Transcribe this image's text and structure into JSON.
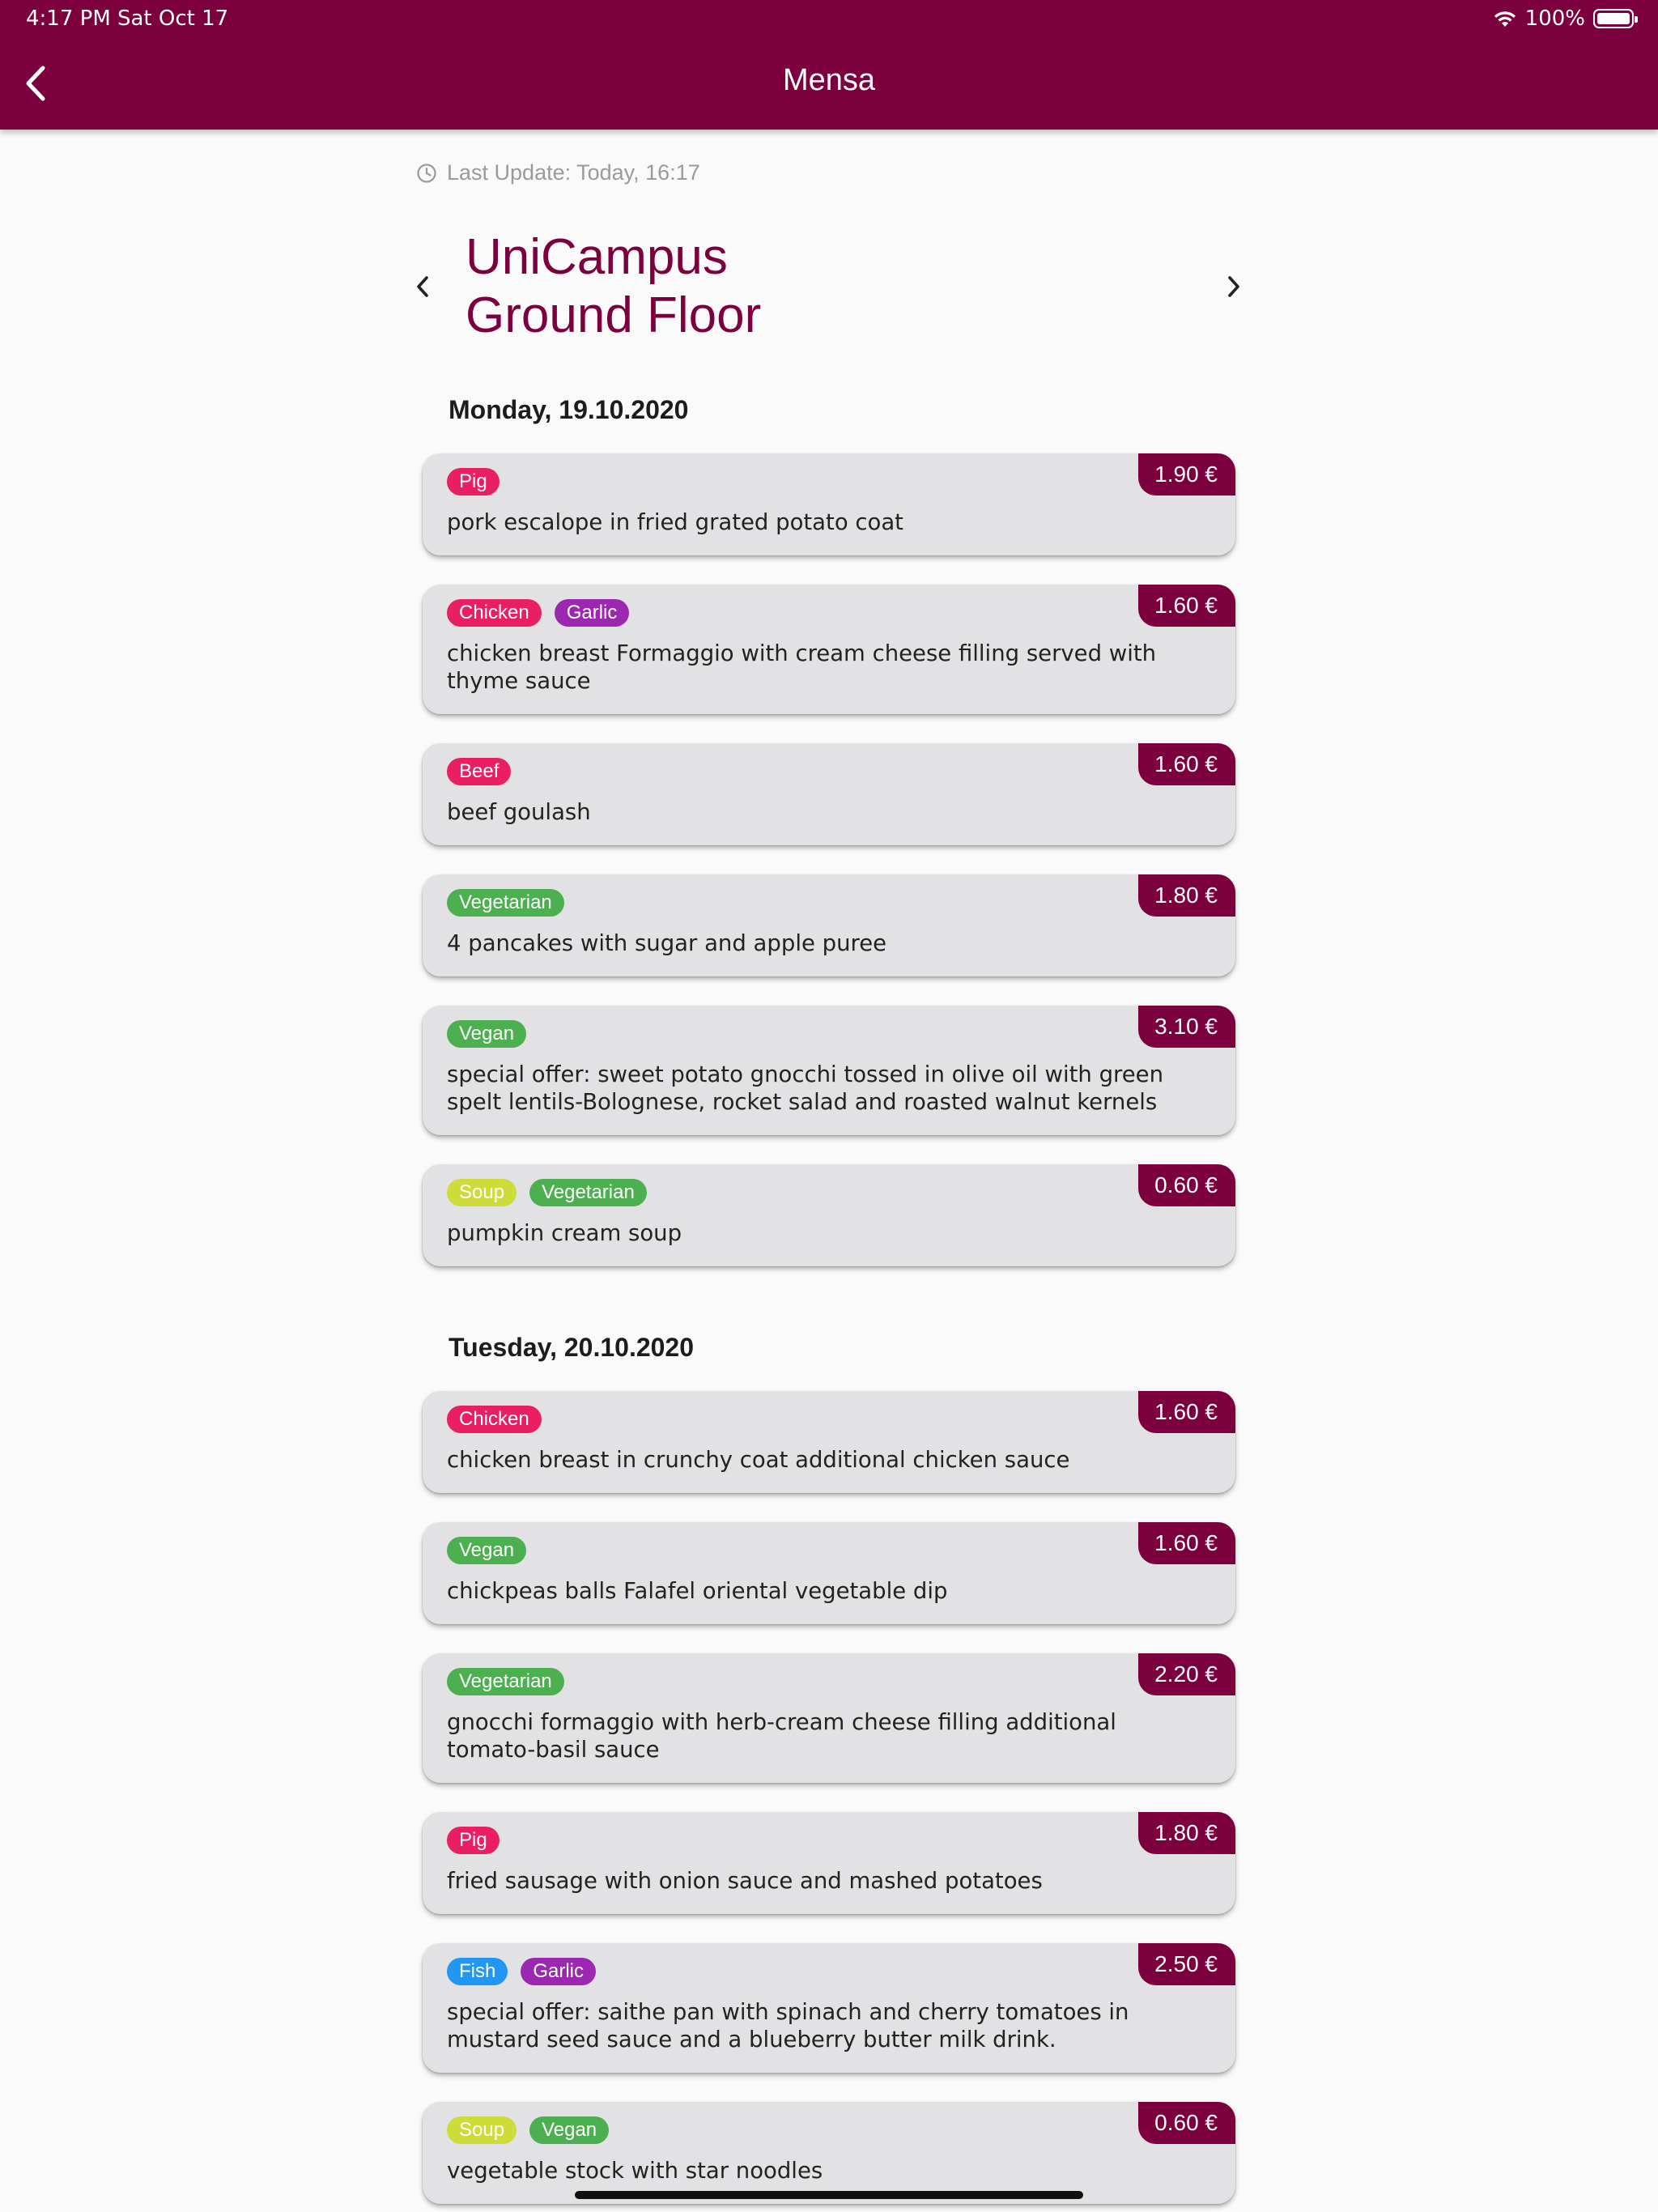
{
  "status_bar": {
    "time": "4:17 PM",
    "date": "Sat Oct 17",
    "battery": "100%"
  },
  "appbar": {
    "title": "Mensa"
  },
  "last_update": "Last Update: Today, 16:17",
  "location": {
    "line1": "UniCampus",
    "line2": "Ground Floor"
  },
  "colors": {
    "brand": "#7b003d",
    "tag_meat": "#e91e63",
    "tag_garlic": "#9c27b0",
    "tag_veg": "#4caf50",
    "tag_soup": "#cddc39",
    "tag_fish": "#2196f3"
  },
  "days": [
    {
      "date": "Monday, 19.10.2020",
      "meals": [
        {
          "tags": [
            "Pig"
          ],
          "name": "pork escalope in fried grated potato coat",
          "price": "1.90 €"
        },
        {
          "tags": [
            "Chicken",
            "Garlic"
          ],
          "name": "chicken breast Formaggio with cream cheese filling served with thyme sauce",
          "price": "1.60 €"
        },
        {
          "tags": [
            "Beef"
          ],
          "name": "beef goulash",
          "price": "1.60 €"
        },
        {
          "tags": [
            "Vegetarian"
          ],
          "name": "4 pancakes with sugar and apple puree",
          "price": "1.80 €"
        },
        {
          "tags": [
            "Vegan"
          ],
          "name": "special offer: sweet potato gnocchi tossed in olive oil with green spelt lentils-Bolognese, rocket salad and roasted walnut kernels",
          "price": "3.10 €"
        },
        {
          "tags": [
            "Soup",
            "Vegetarian"
          ],
          "name": "pumpkin cream soup",
          "price": "0.60 €"
        }
      ]
    },
    {
      "date": "Tuesday, 20.10.2020",
      "meals": [
        {
          "tags": [
            "Chicken"
          ],
          "name": "chicken breast in crunchy coat additional chicken sauce",
          "price": "1.60 €"
        },
        {
          "tags": [
            "Vegan"
          ],
          "name": "chickpeas balls Falafel oriental vegetable dip",
          "price": "1.60 €"
        },
        {
          "tags": [
            "Vegetarian"
          ],
          "name": "gnocchi formaggio with herb-cream cheese filling additional tomato-basil sauce",
          "price": "2.20 €"
        },
        {
          "tags": [
            "Pig"
          ],
          "name": "fried sausage with onion sauce and mashed potatoes",
          "price": "1.80 €"
        },
        {
          "tags": [
            "Fish",
            "Garlic"
          ],
          "name": "special offer: saithe pan with spinach and cherry tomatoes in mustard seed sauce and a blueberry butter milk drink.",
          "price": "2.50 €"
        },
        {
          "tags": [
            "Soup",
            "Vegan"
          ],
          "name": "vegetable stock with star noodles",
          "price": "0.60 €"
        }
      ]
    }
  ]
}
